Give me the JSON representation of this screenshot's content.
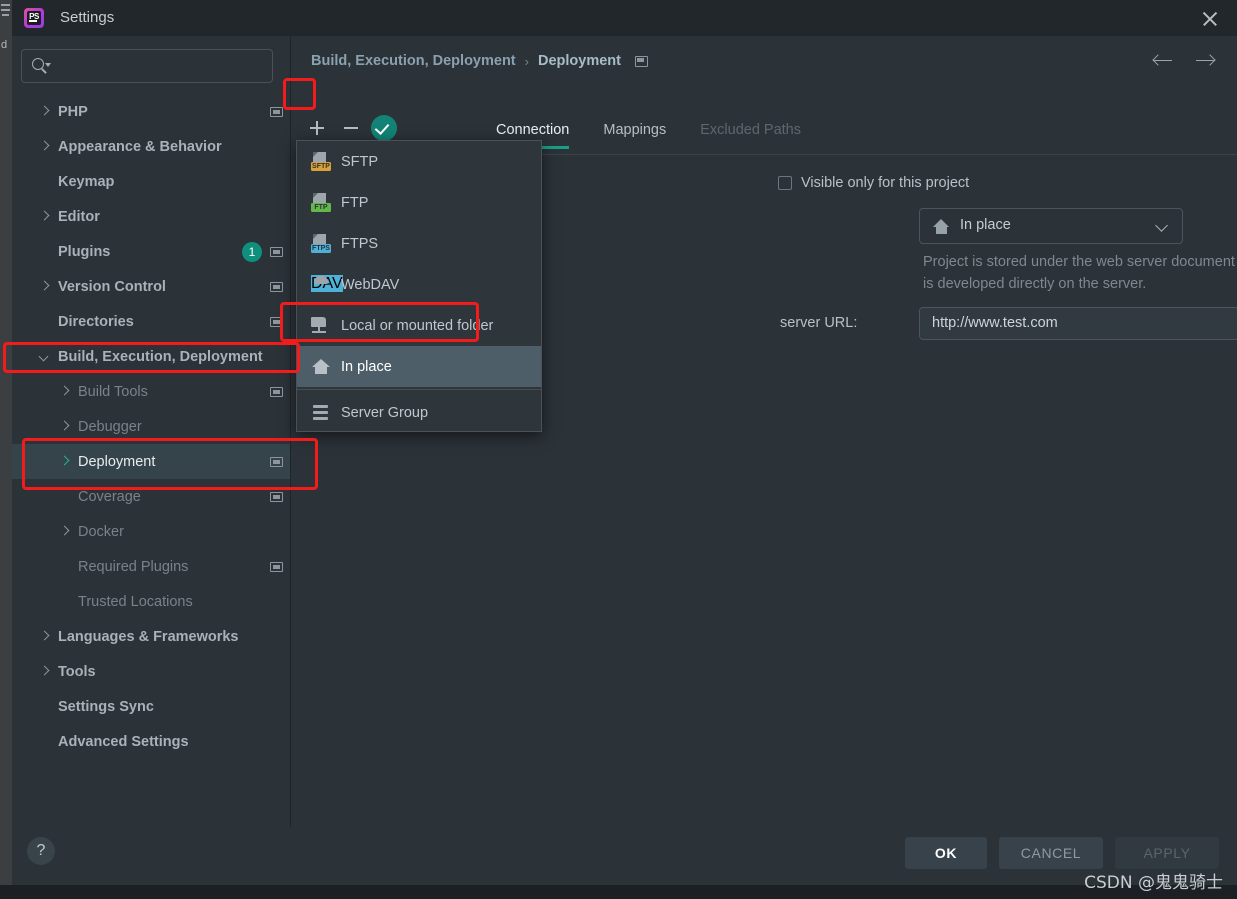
{
  "window": {
    "title": "Settings",
    "logo_text": "PS",
    "logo_name": "phpstorm-logo",
    "close_label": "×"
  },
  "search": {
    "placeholder": "",
    "value": "",
    "icon": "search-icon"
  },
  "sidebar": {
    "items": [
      {
        "label": "PHP",
        "level": 0,
        "arrow": "right",
        "bold": true,
        "module_icon": true,
        "badge": null,
        "selected": false,
        "dim": false
      },
      {
        "label": "Appearance & Behavior",
        "level": 0,
        "arrow": "right",
        "bold": true,
        "module_icon": false,
        "badge": null,
        "selected": false,
        "dim": false
      },
      {
        "label": "Keymap",
        "level": 0,
        "arrow": "none",
        "bold": true,
        "module_icon": false,
        "badge": null,
        "selected": false,
        "dim": false
      },
      {
        "label": "Editor",
        "level": 0,
        "arrow": "right",
        "bold": true,
        "module_icon": false,
        "badge": null,
        "selected": false,
        "dim": false
      },
      {
        "label": "Plugins",
        "level": 0,
        "arrow": "none",
        "bold": true,
        "module_icon": true,
        "badge": "1",
        "selected": false,
        "dim": false
      },
      {
        "label": "Version Control",
        "level": 0,
        "arrow": "right",
        "bold": true,
        "module_icon": true,
        "badge": null,
        "selected": false,
        "dim": false
      },
      {
        "label": "Directories",
        "level": 0,
        "arrow": "none",
        "bold": true,
        "module_icon": true,
        "badge": null,
        "selected": false,
        "dim": false
      },
      {
        "label": "Build, Execution, Deployment",
        "level": 0,
        "arrow": "down",
        "bold": true,
        "module_icon": false,
        "badge": null,
        "selected": false,
        "dim": false
      },
      {
        "label": "Build Tools",
        "level": 1,
        "arrow": "right",
        "bold": false,
        "module_icon": true,
        "badge": null,
        "selected": false,
        "dim": true
      },
      {
        "label": "Debugger",
        "level": 1,
        "arrow": "right",
        "bold": false,
        "module_icon": false,
        "badge": null,
        "selected": false,
        "dim": true
      },
      {
        "label": "Deployment",
        "level": 1,
        "arrow": "right",
        "bold": false,
        "module_icon": true,
        "badge": null,
        "selected": true,
        "dim": false
      },
      {
        "label": "Coverage",
        "level": 1,
        "arrow": "none",
        "bold": false,
        "module_icon": true,
        "badge": null,
        "selected": false,
        "dim": true
      },
      {
        "label": "Docker",
        "level": 1,
        "arrow": "right",
        "bold": false,
        "module_icon": false,
        "badge": null,
        "selected": false,
        "dim": true
      },
      {
        "label": "Required Plugins",
        "level": 1,
        "arrow": "none",
        "bold": false,
        "module_icon": true,
        "badge": null,
        "selected": false,
        "dim": true
      },
      {
        "label": "Trusted Locations",
        "level": 1,
        "arrow": "none",
        "bold": false,
        "module_icon": false,
        "badge": null,
        "selected": false,
        "dim": true
      },
      {
        "label": "Languages & Frameworks",
        "level": 0,
        "arrow": "right",
        "bold": true,
        "module_icon": false,
        "badge": null,
        "selected": false,
        "dim": false
      },
      {
        "label": "Tools",
        "level": 0,
        "arrow": "right",
        "bold": true,
        "module_icon": false,
        "badge": null,
        "selected": false,
        "dim": false
      },
      {
        "label": "Settings Sync",
        "level": 0,
        "arrow": "none",
        "bold": true,
        "module_icon": false,
        "badge": null,
        "selected": false,
        "dim": false
      },
      {
        "label": "Advanced Settings",
        "level": 0,
        "arrow": "none",
        "bold": true,
        "module_icon": false,
        "badge": null,
        "selected": false,
        "dim": false
      }
    ]
  },
  "breadcrumb": {
    "parent": "Build, Execution, Deployment",
    "separator": "›",
    "current": "Deployment"
  },
  "nav": {
    "back_icon": "arrow-left-icon",
    "forward_icon": "arrow-right-icon"
  },
  "toolbar": {
    "add_icon": "plus-icon",
    "remove_icon": "minus-icon",
    "default_icon": "check-circle-icon"
  },
  "tabs": [
    {
      "label": "Connection",
      "active": true,
      "disabled": false
    },
    {
      "label": "Mappings",
      "active": false,
      "disabled": false
    },
    {
      "label": "Excluded Paths",
      "active": false,
      "disabled": true
    }
  ],
  "content": {
    "visible_only_label": "Visible only for this project",
    "visible_only_checked": false,
    "type_select": {
      "value": "In place",
      "icon": "home-icon"
    },
    "description_line1": "Project is stored under the web server document root and",
    "description_line2": "is developed directly on the server.",
    "url_label": "server URL:",
    "url_value": "http://www.test.com",
    "url_icon": "globe-icon"
  },
  "popup_menu": {
    "items": [
      {
        "label": "SFTP",
        "icon": "sftp-icon",
        "highlight": false,
        "separator_after": false
      },
      {
        "label": "FTP",
        "icon": "ftp-icon",
        "highlight": false,
        "separator_after": false
      },
      {
        "label": "FTPS",
        "icon": "ftps-icon",
        "highlight": false,
        "separator_after": false
      },
      {
        "label": "WebDAV",
        "icon": "webdav-icon",
        "highlight": false,
        "separator_after": false
      },
      {
        "label": "Local or mounted folder",
        "icon": "folder-network-icon",
        "highlight": false,
        "separator_after": false
      },
      {
        "label": "In place",
        "icon": "home-icon",
        "highlight": true,
        "separator_after": true
      },
      {
        "label": "Server Group",
        "icon": "server-group-icon",
        "highlight": false,
        "separator_after": false
      }
    ]
  },
  "footer": {
    "help_label": "?",
    "ok_label": "OK",
    "cancel_label": "CANCEL",
    "apply_label": "APPLY"
  },
  "watermark": "CSDN @鬼鬼骑士",
  "colors": {
    "accent_teal": "#17a085",
    "annotation_red": "#f31b1b",
    "panel_bg": "#2b3238",
    "titlebar_bg": "#22272b",
    "selection_bg": "#35444b",
    "badge_green": "#0f8f7d"
  }
}
